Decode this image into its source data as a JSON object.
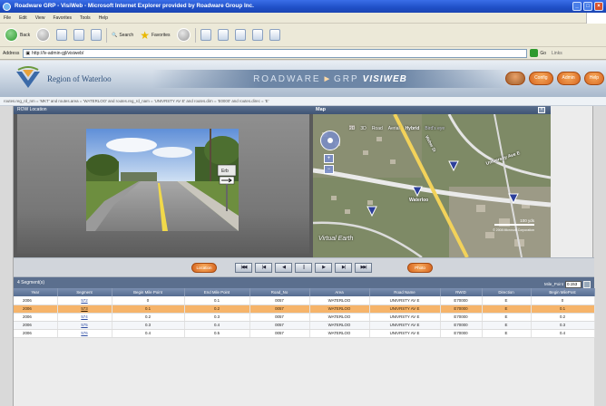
{
  "browser": {
    "title": "Roadware GRP - VisiWeb - Microsoft Internet Explorer provided by Roadware Group Inc.",
    "menu": [
      "File",
      "Edit",
      "View",
      "Favorites",
      "Tools",
      "Help"
    ],
    "toolbar": {
      "back": "Back",
      "search": "Search",
      "favorites": "Favorites"
    },
    "address_label": "Address",
    "address_value": "http://lv-admin-gjl/visiweb/",
    "go_label": "Go",
    "links_label": "Links"
  },
  "app": {
    "logo_text": "Region of Waterloo",
    "banner": {
      "left": "ROADWARE",
      "mid": "GRP",
      "right": "VISIWEB"
    },
    "header_buttons": [
      "Config",
      "Admin",
      "Help"
    ],
    "query_string": "routes.reg_rd_nm = 'MKT' and routes.area = 'WATERLOO' and routes.reg_rd_nam = 'UNIVRSTY AV E' and routes.dirn = 'E0000' and routes.direc = 'E'"
  },
  "video": {
    "panel_title": "ROW Location",
    "sign_text": "Erb"
  },
  "map": {
    "panel_title": "Map",
    "close": "×",
    "tabs": [
      "2D",
      "3D",
      "Road",
      "Aerial",
      "Hybrid",
      "Bird's eye"
    ],
    "selected_tab": "Hybrid",
    "label_waterloo": "Waterloo",
    "label_street": "University Ave E",
    "label_road": "Weber St",
    "scale_text": "100 yds",
    "brand": "Virtual Earth",
    "copyright": "© 2008 Microsoft Corporation"
  },
  "playback": {
    "left_button": "Location",
    "right_button": "Photo",
    "transport": [
      "|◀◀",
      "|◀",
      "◀",
      "||",
      "▶",
      "▶|",
      "▶▶|"
    ]
  },
  "segments": {
    "title": "4 Segment(s)",
    "mile_point_label": "Mile_Point",
    "mile_point_value": "0.153",
    "columns": [
      "Year",
      "Segment",
      "Begin Mile Point",
      "End Mile Point",
      "Road_No",
      "Area",
      "Road Name",
      "RWID",
      "Direction",
      "Begin MilePost"
    ],
    "rows": [
      [
        "2006",
        "572",
        "0",
        "0.1",
        "0057",
        "WATERLOO",
        "UNIVRSTY AV E",
        "E70000",
        "E",
        "0"
      ],
      [
        "2006",
        "573",
        "0.1",
        "0.2",
        "0057",
        "WATERLOO",
        "UNIVRSTY AV E",
        "E70000",
        "E",
        "0.1"
      ],
      [
        "2006",
        "574",
        "0.2",
        "0.3",
        "0057",
        "WATERLOO",
        "UNIVRSTY AV E",
        "E70000",
        "E",
        "0.2"
      ],
      [
        "2006",
        "575",
        "0.3",
        "0.4",
        "0057",
        "WATERLOO",
        "UNIVRSTY AV E",
        "E70000",
        "E",
        "0.3"
      ],
      [
        "2006",
        "576",
        "0.4",
        "0.5",
        "0057",
        "WATERLOO",
        "UNIVRSTY AV E",
        "E70000",
        "E",
        "0.4"
      ]
    ],
    "selected_row": 1
  }
}
